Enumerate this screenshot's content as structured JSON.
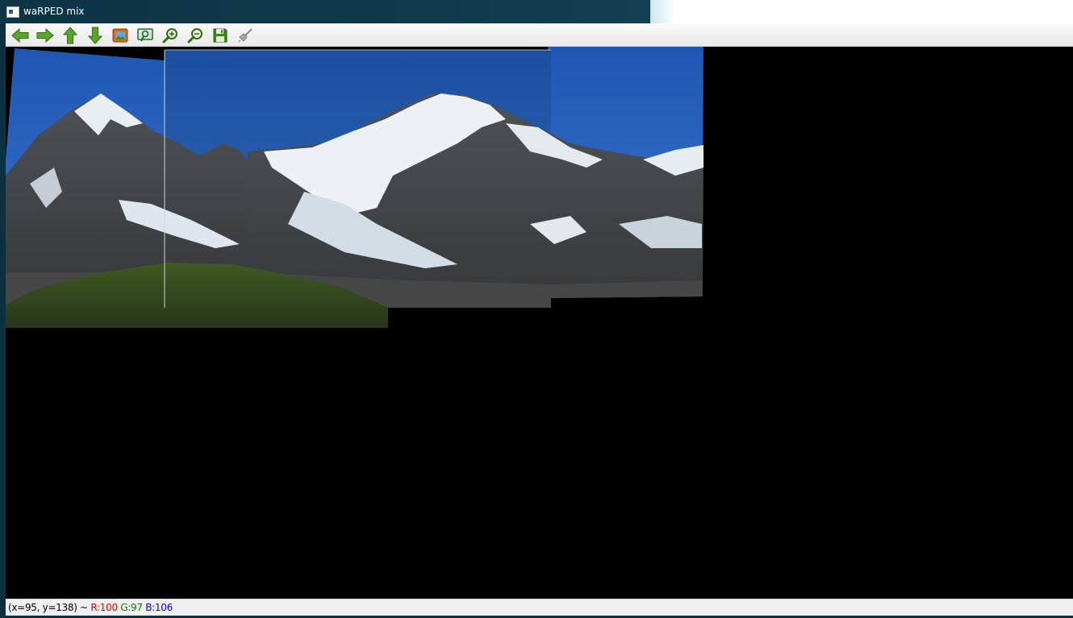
{
  "window": {
    "title": "waRPED mix"
  },
  "toolbar": {
    "buttons": [
      {
        "icon": "arrow-left-icon",
        "name": "pan-left-button"
      },
      {
        "icon": "arrow-right-icon",
        "name": "pan-right-button"
      },
      {
        "icon": "arrow-up-icon",
        "name": "pan-up-button"
      },
      {
        "icon": "arrow-down-icon",
        "name": "pan-down-button"
      },
      {
        "icon": "image-icon",
        "name": "fit-window-button"
      },
      {
        "icon": "zoom-window-icon",
        "name": "zoom-window-button"
      },
      {
        "icon": "zoom-in-icon",
        "name": "zoom-in-button"
      },
      {
        "icon": "zoom-out-icon",
        "name": "zoom-out-button"
      },
      {
        "icon": "save-icon",
        "name": "save-button"
      },
      {
        "icon": "properties-icon",
        "name": "properties-button"
      }
    ]
  },
  "status": {
    "coords": "(x=95, y=138) ~ ",
    "r": "R:100",
    "g": "G:97",
    "b": "B:106",
    "colors": {
      "r": "#e00000",
      "g": "#008000",
      "b": "#0000e0"
    }
  }
}
